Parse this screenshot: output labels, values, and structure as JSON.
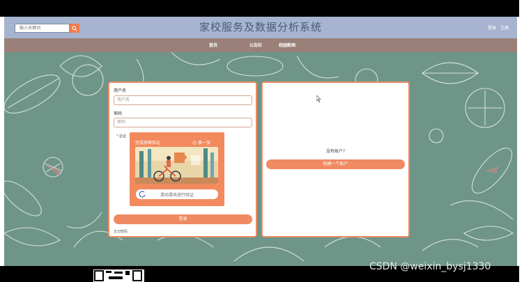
{
  "header": {
    "search_placeholder": "输入关键词",
    "title": "家校服务及数据分析系统",
    "login_link": "登录",
    "register_link": "注册"
  },
  "nav": {
    "items": [
      {
        "label": "首页"
      },
      {
        "label": "公告栏"
      },
      {
        "label": "校园新闻"
      }
    ]
  },
  "login": {
    "username_label": "用户名",
    "username_placeholder": "用户名",
    "password_label": "密码",
    "password_placeholder": "密码",
    "captcha_label": "* 验证",
    "captcha_title": "完成拼图验证",
    "captcha_refresh": "换一张",
    "slider_text": "滑动滑块进行验证",
    "login_button": "登录",
    "forgot_link": "忘记密码"
  },
  "register": {
    "no_account_text": "没有账户?",
    "create_button": "创建一个账户"
  },
  "watermark": "CSDN @weixin_bysj1330",
  "colors": {
    "accent": "#f08a62",
    "header_bg": "#a6b4cf",
    "nav_bg": "#9a8078",
    "hero_bg": "#6f9588"
  }
}
